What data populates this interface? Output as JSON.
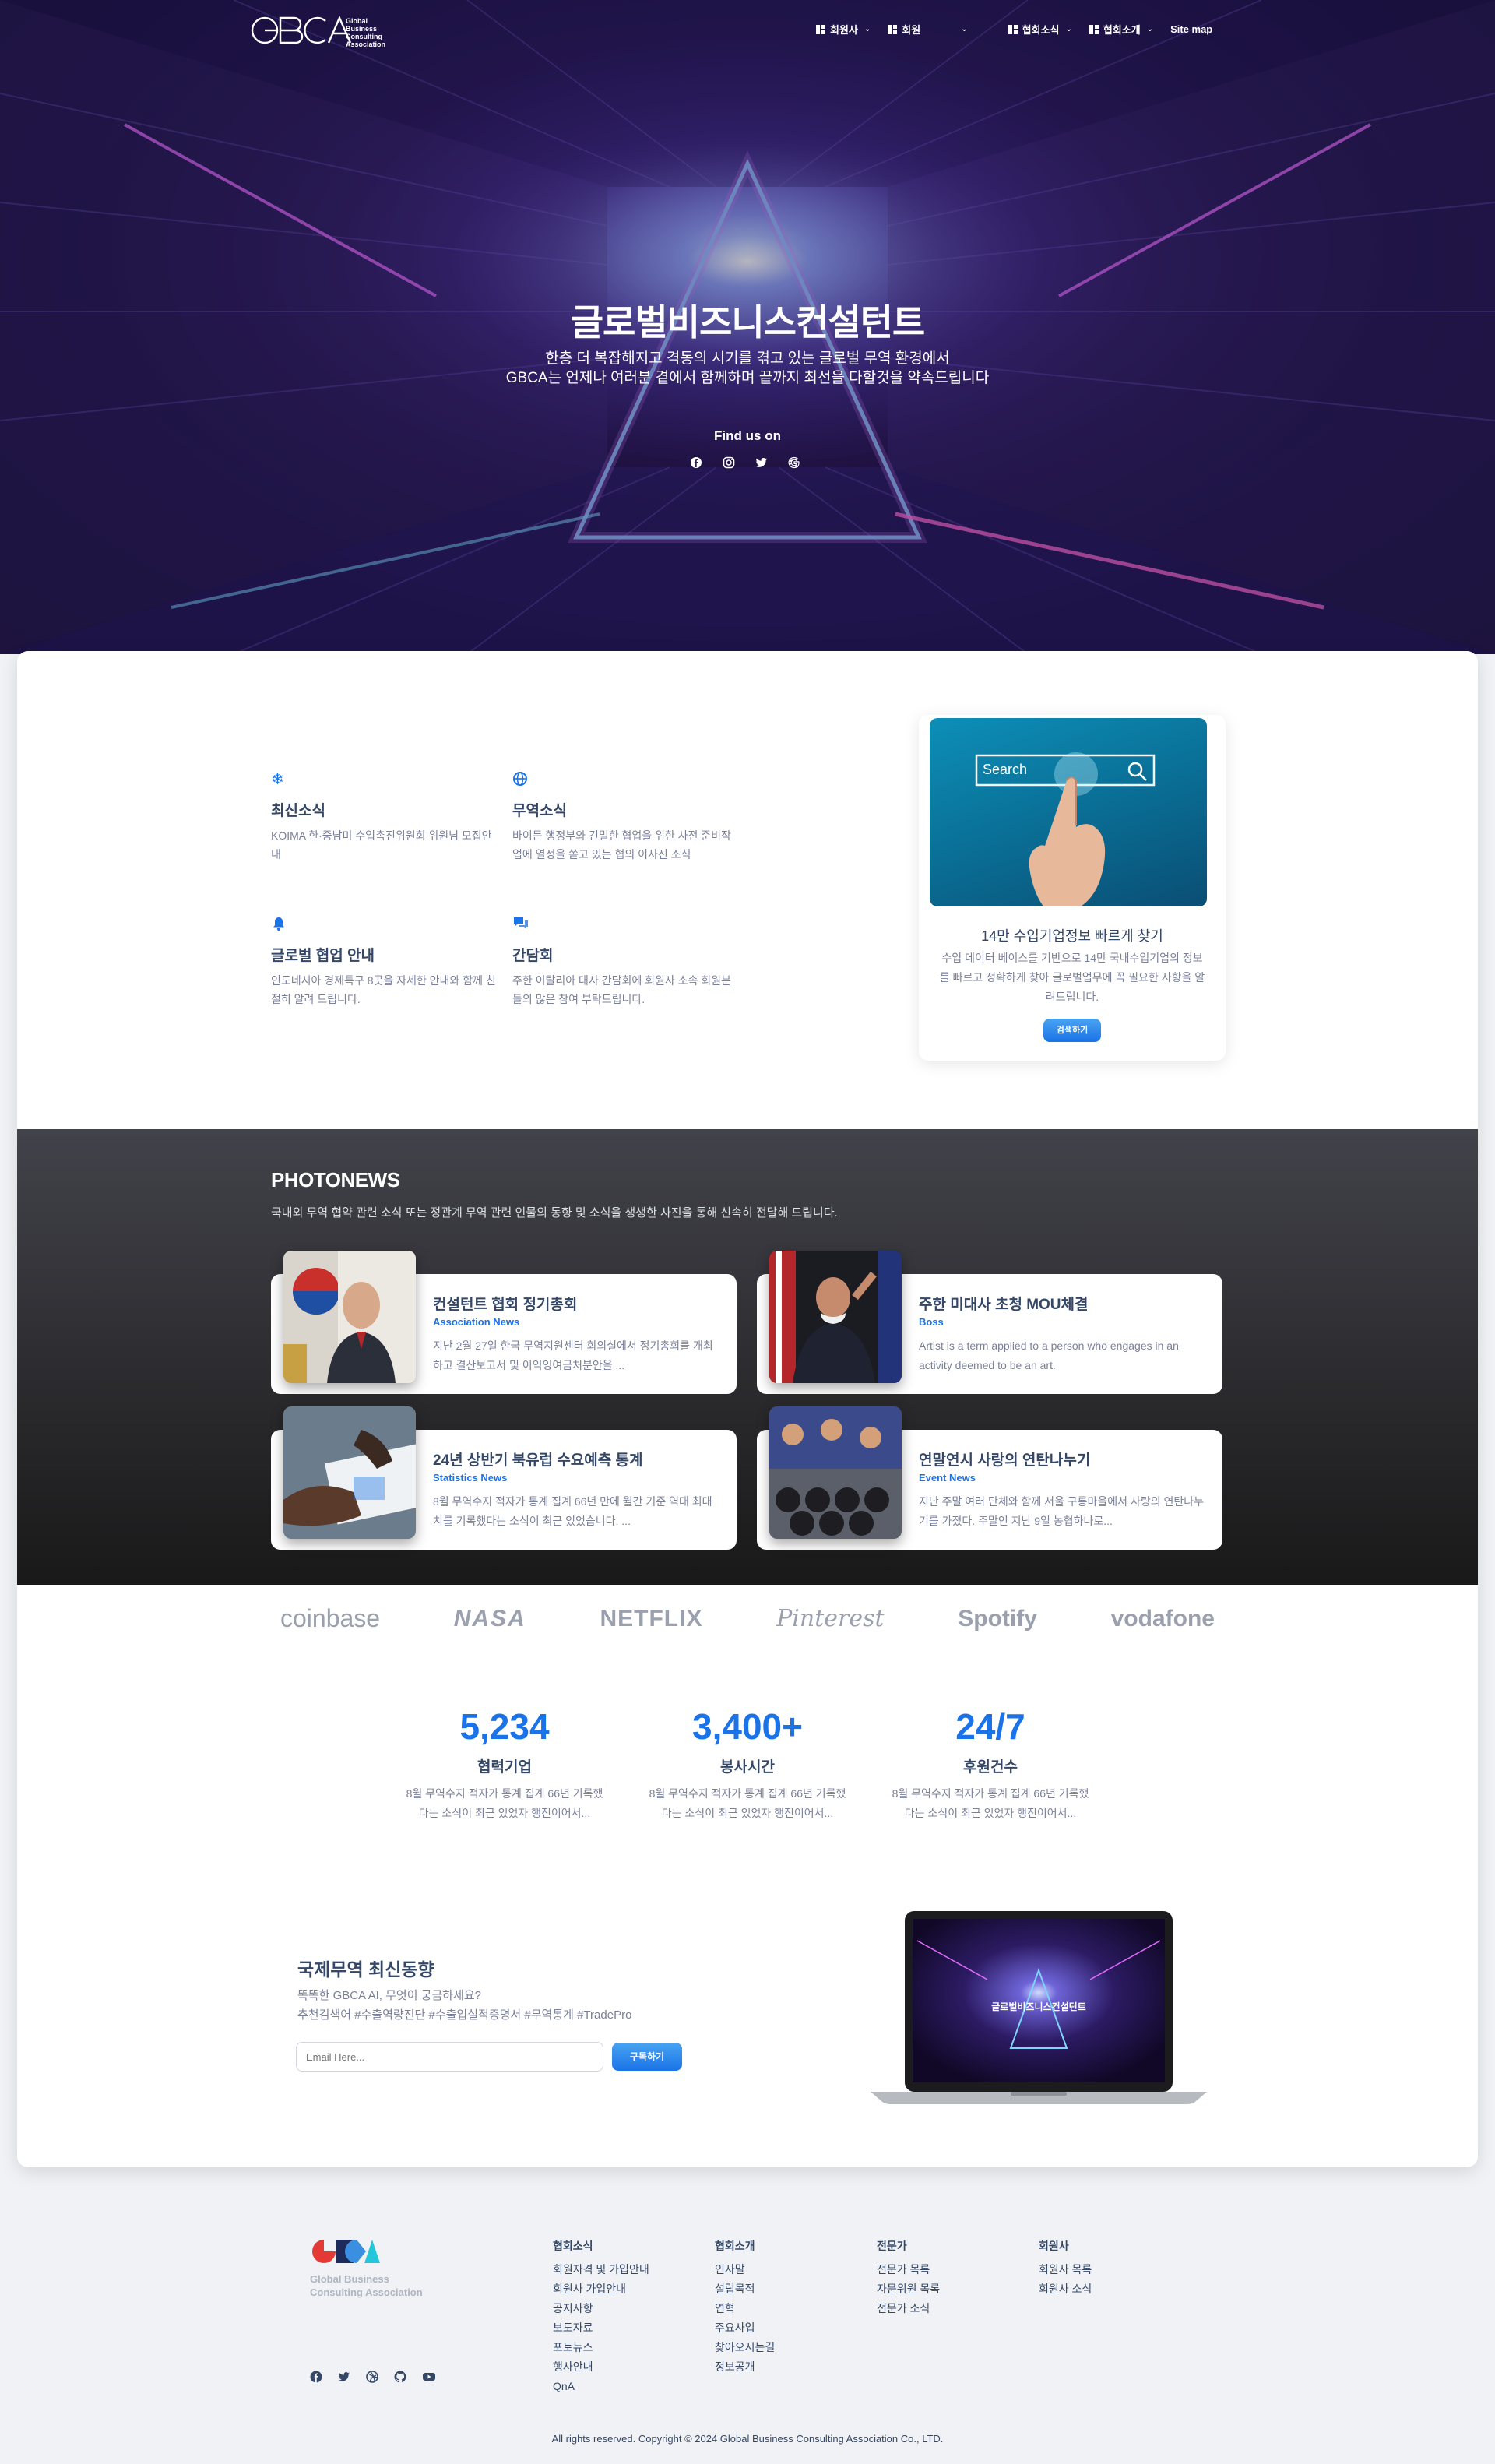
{
  "header": {
    "logo_text": "Global Business Consulting Association",
    "logo_letters": "GBCA",
    "nav": [
      {
        "label": "회원사"
      },
      {
        "label": "회원"
      },
      {
        "label": "협회소식"
      },
      {
        "label": "협회소개"
      }
    ],
    "sitemap": "Site map"
  },
  "hero": {
    "title": "글로벌비즈니스컨설턴트",
    "subtitle_line1": "한층 더 복잡해지고 격동의 시기를 겪고 있는 글로벌 무역 환경에서",
    "subtitle_line2": "GBCA는 언제나 여러분 곁에서 함께하며 끝까지 최선을 다할것을 약속드립니다",
    "find_us": "Find us on",
    "social_icons": [
      "facebook-icon",
      "instagram-icon",
      "twitter-icon",
      "google-icon"
    ]
  },
  "features": [
    {
      "icon": "snowflake-icon",
      "title": "최신소식",
      "text": "KOIMA 한·중남미 수입촉진위원회 위원님 모집안내"
    },
    {
      "icon": "globe-icon",
      "title": "무역소식",
      "text": "바이든 행정부와 긴밀한 협업을 위한 사전 준비작업에 열정을 쏟고 있는 협의 이사진 소식"
    },
    {
      "icon": "bell-icon",
      "title": "글로벌 협업 안내",
      "text": "인도네시아 경제특구 8곳을 자세한 안내와 함께 친절히 알려 드립니다."
    },
    {
      "icon": "chat-icon",
      "title": "간담회",
      "text": "주한 이탈리아 대사 간담회에 회원사 소속 회원분들의 많은 참여 부탁드립니다."
    }
  ],
  "search_card": {
    "image_text": "Search",
    "title": "14만 수입기업정보 빠르게 찾기",
    "text": "수입 데이터 베이스를 기반으로 14만 국내수입기업의 정보를 빠르고 정확하게 찾아 글로벌업무에 꼭 필요한 사항을 알려드립니다.",
    "button": "검색하기"
  },
  "photonews": {
    "title": "PHOTONEWS",
    "lead": "국내외 무역 협약 관련 소식 또는 정관계 무역 관련 인물의 동향 및 소식을 생생한 사진을 통해 신속히 전달해 드립니다.",
    "items": [
      {
        "title": "컨설턴트 협회 정기총회",
        "category": "Association News",
        "text": "지난 2월 27일 한국 무역지원센터 회의실에서 정기총회를 개최하고 결산보고서 및 이익잉여금처분안을 ..."
      },
      {
        "title": "주한 미대사 초청 MOU체결",
        "category": "Boss",
        "text": "Artist is a term applied to a person who engages in an activity deemed to be an art."
      },
      {
        "title": "24년 상반기 북유럽 수요예측 통계",
        "category": "Statistics News",
        "text": "8월 무역수지 적자가 통계 집계 66년 만에 월간 기준 역대 최대치를 기록했다는 소식이 최근 있었습니다. ..."
      },
      {
        "title": "연말연시 사랑의 연탄나누기",
        "category": "Event News",
        "text": "지난 주말 여러 단체와 함께 서울 구룡마을에서 사랑의 연탄나누기를 가졌다. 주말인 지난 9일 농협하나로..."
      }
    ]
  },
  "brands": [
    "coinbase",
    "NASA",
    "NETFLIX",
    "Pinterest",
    "Spotify",
    "vodafone"
  ],
  "stats": [
    {
      "value": "5,234",
      "label": "협력기업",
      "text1": "8월 무역수지 적자가 통계 집계 66년 기록했",
      "text2": "다는 소식이 최근 있었자 행진이어서..."
    },
    {
      "value": "3,400+",
      "label": "봉사시간",
      "text1": "8월 무역수지 적자가 통계 집계 66년 기록했",
      "text2": "다는 소식이 최근 있었자 행진이어서..."
    },
    {
      "value": "24/7",
      "label": "후원건수",
      "text1": "8월 무역수지 적자가 통계 집계 66년 기록했",
      "text2": "다는 소식이 최근 있었자 행진이어서..."
    }
  ],
  "newsletter": {
    "title": "국제무역 최신동향",
    "line1": "똑똑한 GBCA AI, 무엇이 궁금하세요?",
    "line2": "추천검색어 #수출역량진단 #수출입실적증명서 #무역통계 #TradePro",
    "placeholder": "Email Here...",
    "button": "구독하기",
    "laptop_title": "글로벌비즈니스컨설턴트"
  },
  "footer": {
    "brand_line1": "Global Business",
    "brand_line2": "Consulting Association",
    "columns": [
      {
        "title": "협회소식",
        "links": [
          "회원자격 및 가입안내",
          "회원사 가입안내",
          "공지사항",
          "보도자료",
          "포토뉴스",
          "행사안내",
          "QnA"
        ]
      },
      {
        "title": "협회소개",
        "links": [
          "인사말",
          "설립목적",
          "연혁",
          "주요사업",
          "찾아오시는길",
          "정보공개"
        ]
      },
      {
        "title": "전문가",
        "links": [
          "전문가 목록",
          "자문위원 목록",
          "전문가 소식"
        ]
      },
      {
        "title": "회원사",
        "links": [
          "회원사 목록",
          "회원사 소식"
        ]
      }
    ],
    "social_icons": [
      "facebook-icon",
      "twitter-icon",
      "dribbble-icon",
      "github-icon",
      "youtube-icon"
    ],
    "copyright": "All rights reserved. Copyright © 2024 Global Business Consulting Association Co., LTD."
  },
  "colors": {
    "primary": "#1a73e8",
    "text": "#344767",
    "muted": "#7b809a",
    "dark": "#191919"
  }
}
